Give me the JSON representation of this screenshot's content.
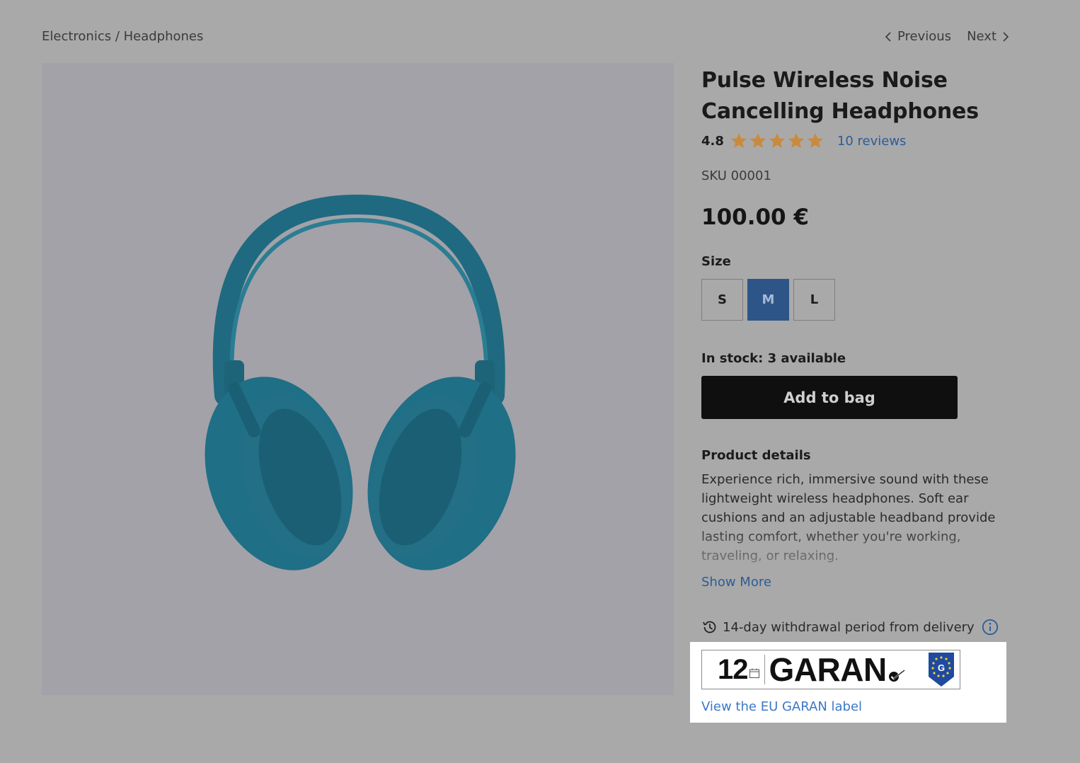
{
  "breadcrumb": {
    "text": "Electronics / Headphones"
  },
  "pager": {
    "previous_label": "Previous",
    "next_label": "Next"
  },
  "product": {
    "title_line1": "Pulse Wireless Noise",
    "title_line2": "Cancelling Headphones",
    "rating": "4.8",
    "stars_filled": 5,
    "reviews_label": "10 reviews",
    "sku": "SKU 00001",
    "price": "100.00 €",
    "size_label": "Size",
    "sizes": [
      "S",
      "M",
      "L"
    ],
    "selected_size": "M",
    "stock": "In stock: 3 available",
    "add_to_bag": "Add to bag",
    "details_heading": "Product details",
    "details_text": "Experience rich, immersive sound with these lightweight wireless headphones. Soft ear cushions and an adjustable headband provide lasting comfort, whether you're working, traveling, or relaxing.",
    "show_more": "Show More",
    "withdrawal": "14-day withdrawal period from delivery"
  },
  "garan": {
    "months": "12",
    "word": "GARAN",
    "link": "View the EU GARAN label"
  },
  "colors": {
    "accent_blue": "#2e5588",
    "link_blue": "#2c5c98",
    "star": "#c98a3e",
    "headphone": "#1f6a80"
  },
  "icons": {
    "prev": "chevron-left-icon",
    "next": "chevron-right-icon",
    "star": "star-icon",
    "history": "history-icon",
    "info": "info-icon",
    "calendar": "calendar-icon",
    "check": "checkmark-icon",
    "eu": "eu-shield-icon"
  }
}
